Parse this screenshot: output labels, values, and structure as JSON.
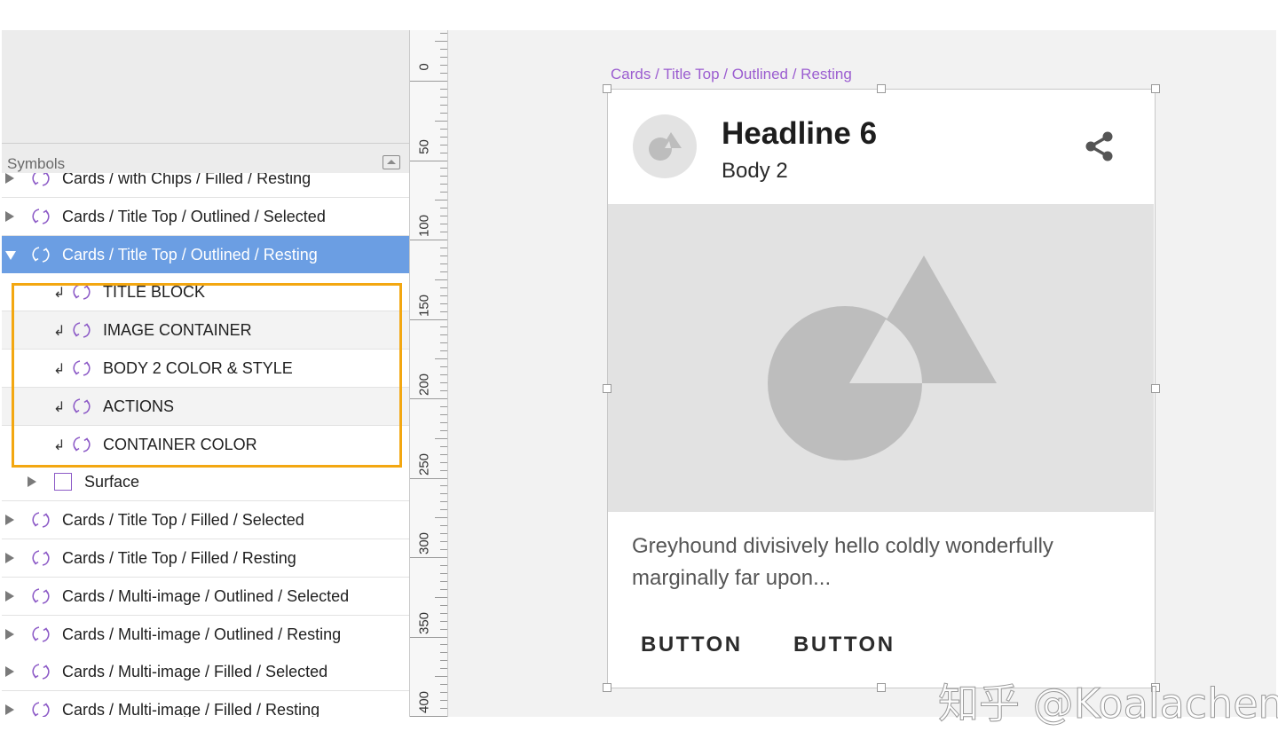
{
  "sidebar": {
    "section_title": "Symbols",
    "layers": [
      {
        "label": "Cards / with Chips / Filled / Resting",
        "type": "symbol"
      },
      {
        "label": "Cards / Title Top / Outlined / Selected",
        "type": "symbol"
      },
      {
        "label": "Cards / Title Top / Outlined / Resting",
        "type": "symbol",
        "selected": true,
        "expanded": true
      },
      {
        "label": "TITLE BLOCK",
        "type": "override"
      },
      {
        "label": "IMAGE CONTAINER",
        "type": "override"
      },
      {
        "label": "BODY 2 COLOR & STYLE",
        "type": "override"
      },
      {
        "label": "ACTIONS",
        "type": "override"
      },
      {
        "label": "CONTAINER COLOR",
        "type": "override"
      },
      {
        "label": "Surface",
        "type": "shape"
      },
      {
        "label": "Cards / Title Top / Filled / Selected",
        "type": "symbol"
      },
      {
        "label": "Cards / Title Top / Filled / Resting",
        "type": "symbol"
      },
      {
        "label": "Cards / Multi-image / Outlined / Selected",
        "type": "symbol"
      },
      {
        "label": "Cards / Multi-image / Outlined / Resting",
        "type": "symbol"
      },
      {
        "label": "Cards / Multi-image / Filled / Selected",
        "type": "symbol"
      },
      {
        "label": "Cards / Multi-image / Filled / Resting",
        "type": "symbol"
      }
    ]
  },
  "ruler": {
    "labels": [
      "0",
      "50",
      "100",
      "150",
      "200",
      "250",
      "300",
      "350",
      "400"
    ]
  },
  "canvas": {
    "artboard_label": "Cards / Title Top / Outlined / Resting",
    "card": {
      "headline": "Headline 6",
      "body2": "Body 2",
      "supporting_text": "Greyhound divisively hello coldly wonderfully marginally far upon...",
      "buttons": [
        "BUTTON",
        "BUTTON"
      ]
    }
  },
  "watermark": "知乎 @Koalachen",
  "colors": {
    "selection": "#6b9ee3",
    "symbol_icon": "#8d5bc7",
    "highlight": "#f3a711",
    "artboard_label": "#9b5dd0"
  }
}
